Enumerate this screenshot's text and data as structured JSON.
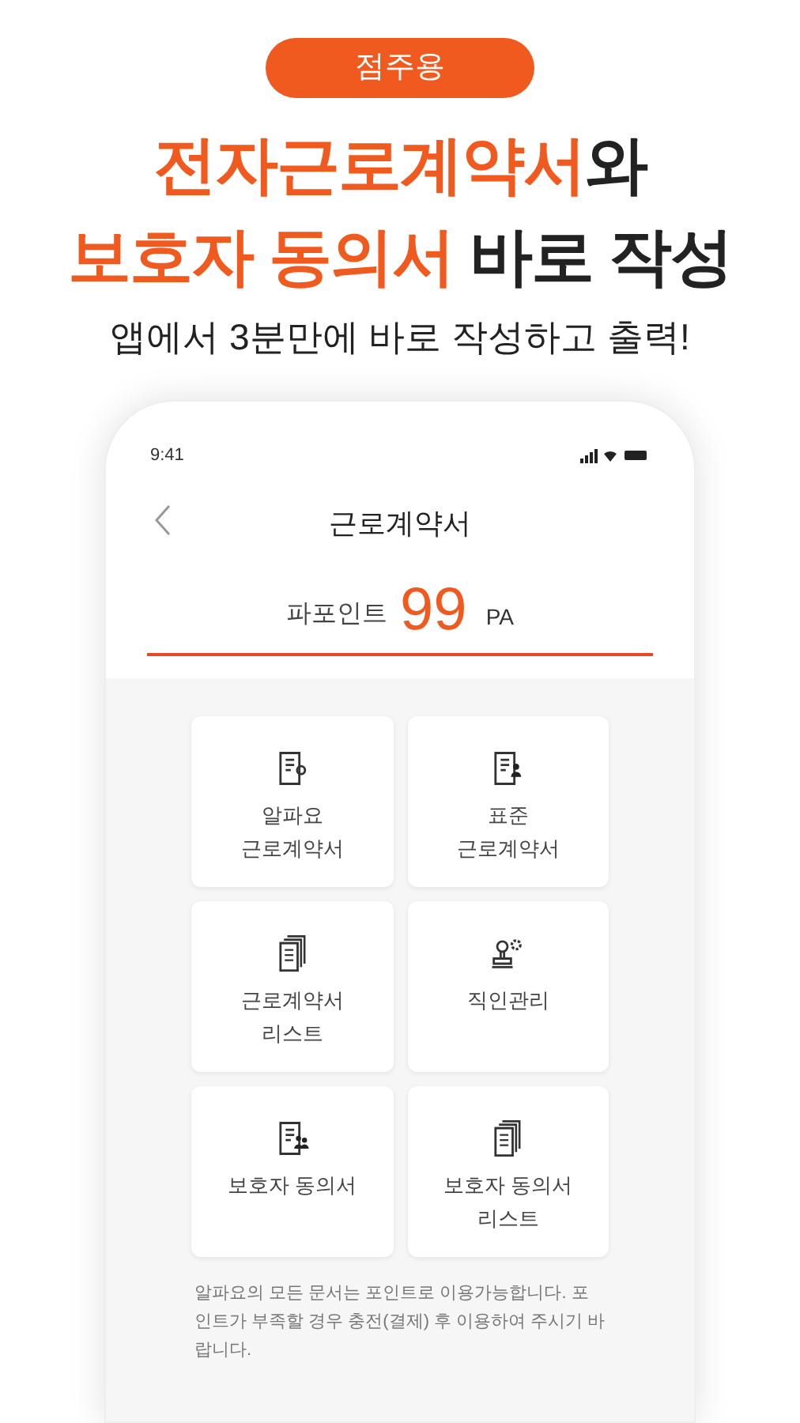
{
  "badge": "점주용",
  "headline": [
    [
      {
        "text": "전자근로계약서",
        "highlight": true
      },
      {
        "text": "와",
        "highlight": false
      }
    ],
    [
      {
        "text": "보호자 동의서",
        "highlight": true
      },
      {
        "text": " 바로 작성",
        "highlight": false
      }
    ]
  ],
  "subtitle": "앱에서 3분만에 바로 작성하고 출력!",
  "phone": {
    "status_time": "9:41",
    "title": "근로계약서",
    "points_label": "파포인트",
    "points_value": "99",
    "points_unit": "PA",
    "menu": [
      {
        "kind": "alpha-doc",
        "lines": [
          "알파요",
          "근로계약서"
        ]
      },
      {
        "kind": "person-doc",
        "lines": [
          "표준",
          "근로계약서"
        ]
      },
      {
        "kind": "doc-stack",
        "lines": [
          "근로계약서",
          "리스트"
        ]
      },
      {
        "kind": "stamp",
        "lines": [
          "직인관리"
        ]
      },
      {
        "kind": "people-doc",
        "lines": [
          "보호자 동의서"
        ]
      },
      {
        "kind": "doc-stack",
        "lines": [
          "보호자 동의서",
          "리스트"
        ]
      }
    ],
    "notice": "알파요의 모든 문서는 포인트로 이용가능합니다. 포인트가 부족할 경우 충전(결제) 후 이용하여 주시기 바랍니다."
  }
}
